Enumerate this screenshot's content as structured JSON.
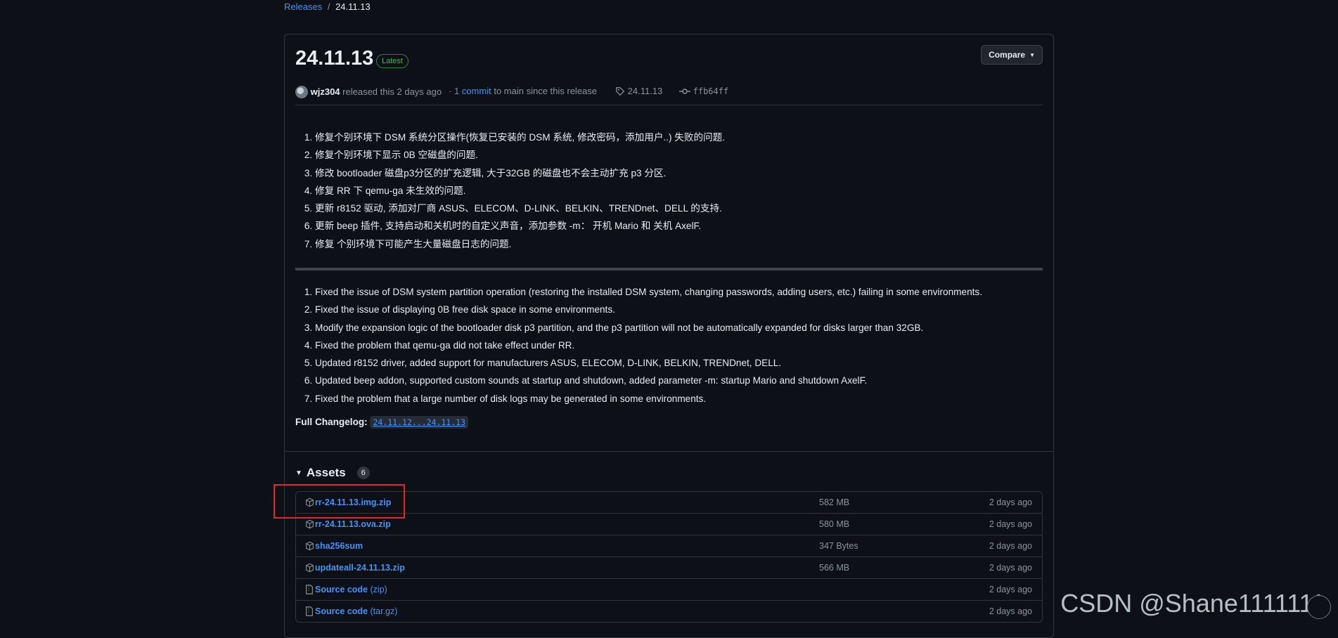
{
  "breadcrumb": {
    "releases": "Releases",
    "separator": "/",
    "current": "24.11.13"
  },
  "release": {
    "title": "24.11.13",
    "badge": "Latest",
    "compare_label": "Compare",
    "author": "wjz304",
    "released_text": "released this 2 days ago",
    "commit_prefix": "·",
    "commit_link": "1 commit",
    "commit_suffix": "to main since this release",
    "tag": "24.11.13",
    "commit_hash": "ffb64ff"
  },
  "notes_cn": [
    "修复个别环境下 DSM 系统分区操作(恢复已安装的 DSM 系统, 修改密码，添加用户..) 失败的问题.",
    "修复个别环境下显示 0B 空磁盘的问题.",
    "修改 bootloader 磁盘p3分区的扩充逻辑, 大于32GB 的磁盘也不会主动扩充 p3 分区.",
    "修复 RR 下 qemu-ga 未生效的问题.",
    "更新 r8152 驱动, 添加对厂商 ASUS、ELECOM、D-LINK、BELKIN、TRENDnet、DELL 的支持.",
    "更新 beep 插件, 支持启动和关机时的自定义声音，添加参数 -m： 开机 Mario 和 关机 AxelF.",
    "修复 个别环境下可能产生大量磁盘日志的问题."
  ],
  "notes_en": [
    "Fixed the issue of DSM system partition operation (restoring the installed DSM system, changing passwords, adding users, etc.) failing in some environments.",
    "Fixed the issue of displaying 0B free disk space in some environments.",
    "Modify the expansion logic of the bootloader disk p3 partition, and the p3 partition will not be automatically expanded for disks larger than 32GB.",
    "Fixed the problem that qemu-ga did not take effect under RR.",
    "Updated r8152 driver, added support for manufacturers ASUS, ELECOM, D-LINK, BELKIN, TRENDnet, DELL.",
    "Updated beep addon, supported custom sounds at startup and shutdown, added parameter -m: startup Mario and shutdown AxelF.",
    "Fixed the problem that a large number of disk logs may be generated in some environments."
  ],
  "changelog": {
    "label": "Full Changelog:",
    "link": "24.11.12...24.11.13"
  },
  "assets": {
    "heading": "Assets",
    "count": "6",
    "items": [
      {
        "name": "rr-24.11.13.img.zip",
        "size": "582 MB",
        "date": "2 days ago",
        "icon": "package-icon"
      },
      {
        "name": "rr-24.11.13.ova.zip",
        "size": "580 MB",
        "date": "2 days ago",
        "icon": "package-icon"
      },
      {
        "name": "sha256sum",
        "size": "347 Bytes",
        "date": "2 days ago",
        "icon": "package-icon"
      },
      {
        "name": "updateall-24.11.13.zip",
        "size": "566 MB",
        "date": "2 days ago",
        "icon": "package-icon"
      },
      {
        "name": "Source code",
        "ext": "(zip)",
        "size": "",
        "date": "2 days ago",
        "icon": "file-zip-icon"
      },
      {
        "name": "Source code",
        "ext": "(tar.gz)",
        "size": "",
        "date": "2 days ago",
        "icon": "file-zip-icon"
      }
    ]
  },
  "watermark": "CSDN @Shane1111111",
  "colors": {
    "link": "#4493f8",
    "badge_green": "#3fb950",
    "highlight_red": "#e8262a",
    "background": "#0d1117"
  }
}
